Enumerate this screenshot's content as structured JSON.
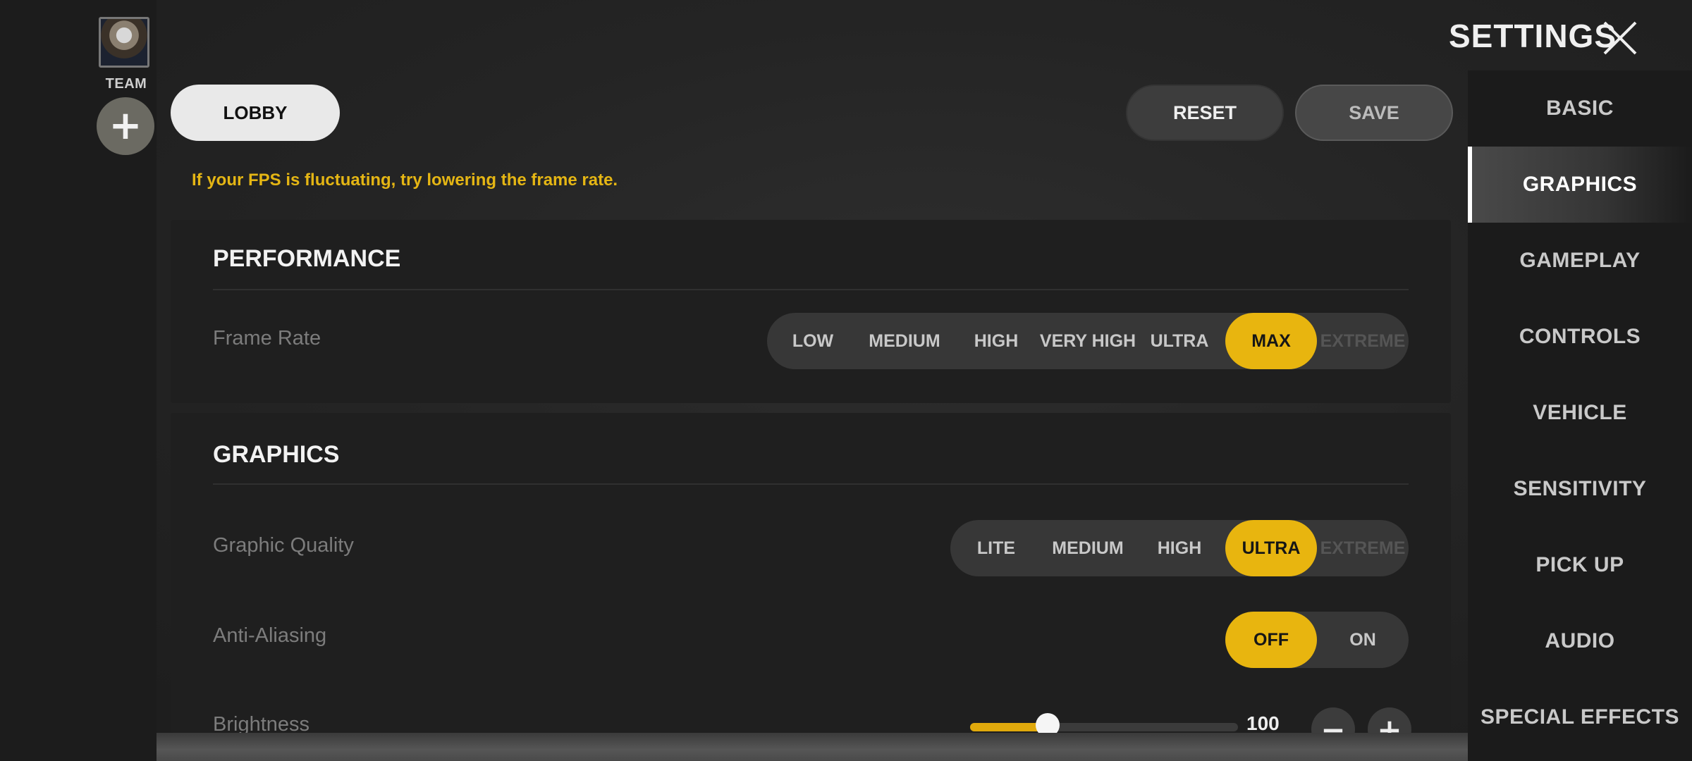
{
  "colors": {
    "accent": "#e8b50f",
    "hint": "#e5b614",
    "background": "#202020"
  },
  "left_rail": {
    "avatar_icon": "player-avatar",
    "team_label": "TEAM",
    "add_team_icon": "+"
  },
  "header": {
    "lobby_label": "LOBBY",
    "title": "SETTINGS",
    "close_icon": "close-x",
    "reset_label": "RESET",
    "save_label": "SAVE"
  },
  "hint": "If your FPS is fluctuating, try lowering the frame rate.",
  "performance": {
    "title": "PERFORMANCE",
    "frame_rate": {
      "label": "Frame Rate",
      "options": [
        "LOW",
        "MEDIUM",
        "HIGH",
        "VERY HIGH",
        "ULTRA",
        "MAX",
        "EXTREME"
      ],
      "selected": "MAX",
      "disabled": [
        "EXTREME"
      ]
    }
  },
  "graphics": {
    "title": "GRAPHICS",
    "graphic_quality": {
      "label": "Graphic Quality",
      "options": [
        "LITE",
        "MEDIUM",
        "HIGH",
        "ULTRA",
        "EXTREME"
      ],
      "selected": "ULTRA",
      "disabled": [
        "EXTREME"
      ]
    },
    "anti_aliasing": {
      "label": "Anti-Aliasing",
      "options": [
        "OFF",
        "ON"
      ],
      "selected": "OFF"
    },
    "brightness": {
      "label": "Brightness",
      "value": "100",
      "slider_fill_fraction": 0.29,
      "minus_icon": "−",
      "plus_icon": "+"
    }
  },
  "side_nav": {
    "active": "GRAPHICS",
    "items": [
      "BASIC",
      "GRAPHICS",
      "GAMEPLAY",
      "CONTROLS",
      "VEHICLE",
      "SENSITIVITY",
      "PICK UP",
      "AUDIO",
      "SPECIAL EFFECTS"
    ]
  }
}
